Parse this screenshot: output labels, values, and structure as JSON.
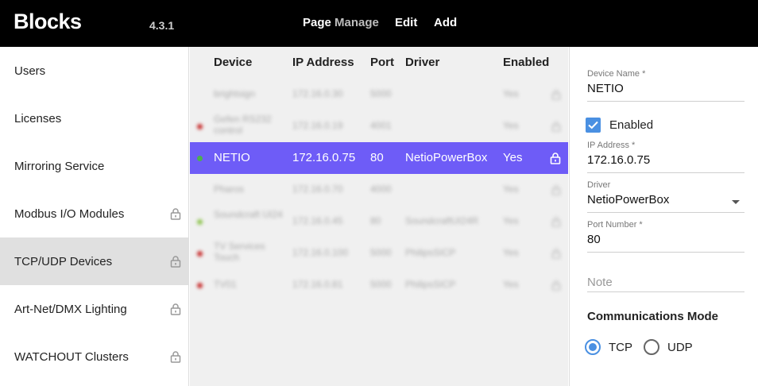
{
  "header": {
    "logo": "Blocks",
    "version": "4.3.1",
    "menu_page": "Page",
    "menu_manage": "Manage",
    "menu_edit": "Edit",
    "menu_add": "Add"
  },
  "sidebar": {
    "items": [
      {
        "label": "Users",
        "locked": false
      },
      {
        "label": "Licenses",
        "locked": false
      },
      {
        "label": "Mirroring Service",
        "locked": false
      },
      {
        "label": "Modbus I/O Modules",
        "locked": true
      },
      {
        "label": "TCP/UDP Devices",
        "locked": true,
        "active": true
      },
      {
        "label": "Art-Net/DMX Lighting",
        "locked": true
      },
      {
        "label": "WATCHOUT Clusters",
        "locked": true
      }
    ]
  },
  "table": {
    "columns": [
      "Device",
      "IP Address",
      "Port",
      "Driver",
      "Enabled"
    ],
    "rows": [
      {
        "device": "brightsign",
        "ip": "172.16.0.30",
        "port": "5000",
        "driver": "",
        "enabled": "Yes",
        "status": "none"
      },
      {
        "device": "Gefen RS232 control",
        "ip": "172.16.0.19",
        "port": "4001",
        "driver": "",
        "enabled": "Yes",
        "status": "#c62828"
      },
      {
        "device": "NETIO",
        "ip": "172.16.0.75",
        "port": "80",
        "driver": "NetioPowerBox",
        "enabled": "Yes",
        "status": "#4caf50",
        "selected": true
      },
      {
        "device": "Pharos",
        "ip": "172.16.0.70",
        "port": "4000",
        "driver": "",
        "enabled": "Yes",
        "status": "none"
      },
      {
        "device": "Soundcraft UI24",
        "ip": "172.16.0.45",
        "port": "80",
        "driver": "SoundcraftUI24R",
        "enabled": "Yes",
        "status": "#8bc34a"
      },
      {
        "device": "TV Services Touch",
        "ip": "172.16.0.100",
        "port": "5000",
        "driver": "PhilipsSICP",
        "enabled": "Yes",
        "status": "#c62828"
      },
      {
        "device": "TV01",
        "ip": "172.16.0.81",
        "port": "5000",
        "driver": "PhilipsSICP",
        "enabled": "Yes",
        "status": "#c62828"
      }
    ]
  },
  "form": {
    "device_name_label": "Device Name *",
    "device_name_value": "NETIO",
    "enabled_label": "Enabled",
    "enabled_checked": true,
    "ip_label": "IP Address *",
    "ip_value": "172.16.0.75",
    "driver_label": "Driver",
    "driver_value": "NetioPowerBox",
    "port_label": "Port Number *",
    "port_value": "80",
    "note_placeholder": "Note",
    "comm_mode_title": "Communications Mode",
    "tcp_label": "TCP",
    "udp_label": "UDP",
    "comm_mode_selected": "TCP"
  },
  "colors": {
    "accent": "#4a90e2",
    "selected_row": "#6e5cf7",
    "topbar": "#000000"
  }
}
